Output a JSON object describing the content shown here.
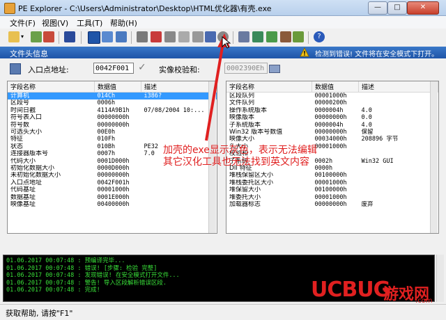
{
  "window": {
    "title": "PE Explorer - C:\\Users\\Administrator\\Desktop\\HTML优化器\\有壳.exe",
    "min_label": "—",
    "max_label": "□",
    "close_label": "✕"
  },
  "menu": [
    "文件(F)",
    "视图(V)",
    "工具(T)",
    "帮助(H)"
  ],
  "header": {
    "title": "文件头信息",
    "warning": "检测到错误! 文件将在安全模式下打开。"
  },
  "fields": {
    "entry_label": "入口点地址:",
    "entry_value": "0042F001",
    "checksum_label": "实像校验和:",
    "checksum_value": "0002390Eh"
  },
  "left_table": {
    "columns": [
      "字段名称",
      "数据值",
      "描述"
    ],
    "rows": [
      [
        "计算机",
        "014Ch",
        "i386?"
      ],
      [
        "区段号",
        "0006h",
        ""
      ],
      [
        "时间日戳",
        "4114A9B1h",
        "07/08/2004  10:..."
      ],
      [
        "符号表入口",
        "00000000h",
        ""
      ],
      [
        "符号数",
        "00000000h",
        ""
      ],
      [
        "可选头大小",
        "00E0h",
        ""
      ],
      [
        "特征",
        "010Fh",
        ""
      ],
      [
        "状态",
        "010Bh",
        "PE32"
      ],
      [
        "连接器版本号",
        "0007h",
        "7.0"
      ],
      [
        "代码大小",
        "0001D000h",
        ""
      ],
      [
        "初始化数据大小",
        "0000D000h",
        ""
      ],
      [
        "未初始化数据大小",
        "00000000h",
        ""
      ],
      [
        "入口点地址",
        "0042F001h",
        ""
      ],
      [
        "代码基址",
        "00001000h",
        ""
      ],
      [
        "数据基址",
        "0001E000h",
        ""
      ],
      [
        "映像基址",
        "00400000h",
        ""
      ]
    ]
  },
  "right_table": {
    "columns": [
      "字段名称",
      "数据值",
      "描述"
    ],
    "rows": [
      [
        "区段队列",
        "00001000h",
        ""
      ],
      [
        "文件队列",
        "00000200h",
        ""
      ],
      [
        "操作系统版本",
        "0000004h",
        "4.0"
      ],
      [
        "映像版本",
        "00000000h",
        "0.0"
      ],
      [
        "子系统版本",
        "0000004h",
        "4.0"
      ],
      [
        "Win32 版本号数值",
        "00000000h",
        "保留"
      ],
      [
        "映像大小",
        "00034000h",
        "208896 字节"
      ],
      [
        "头大小",
        "00001000h",
        ""
      ],
      [
        "校验和",
        "",
        ""
      ],
      [
        "子系统",
        "0002h",
        "Win32 GUI"
      ],
      [
        "Dll 特征",
        "0000h",
        ""
      ],
      [
        "堆栈保留区大小",
        "00100000h",
        ""
      ],
      [
        "堆栈委托区大小",
        "00001000h",
        ""
      ],
      [
        "堆保留大小",
        "00100000h",
        ""
      ],
      [
        "堆委托大小",
        "00001000h",
        ""
      ],
      [
        "加载器标志",
        "00000000h",
        "废弃"
      ]
    ]
  },
  "log_lines": [
    "01.06.2017 00:07:48 : 预编译完毕...",
    "01.06.2017 00:07:48 : 错误! [步骤: 检验 完整]",
    "01.06.2017 00:07:48 : 发现错误! 在安全模式打开文件...",
    "01.06.2017 00:07:48 : 警告! 导入区段解析错误区段.",
    "01.06.2017 00:07:48 : 完成!"
  ],
  "status": "获取帮助, 请按\"F1\"",
  "annotation": {
    "line1": "加壳的exe显示灰色，表示无法编辑",
    "line2": "其它汉化工具也无法找到英文内容"
  },
  "watermark": {
    "brand": "UCBUG",
    "suffix": "游戏网",
    "domain": ".com"
  },
  "colors": {
    "header_bg": "#1f55a8",
    "selection": "#3399ff",
    "log_text": "#39e039",
    "annotation": "#e02020",
    "watermark_red": "#e02020"
  }
}
